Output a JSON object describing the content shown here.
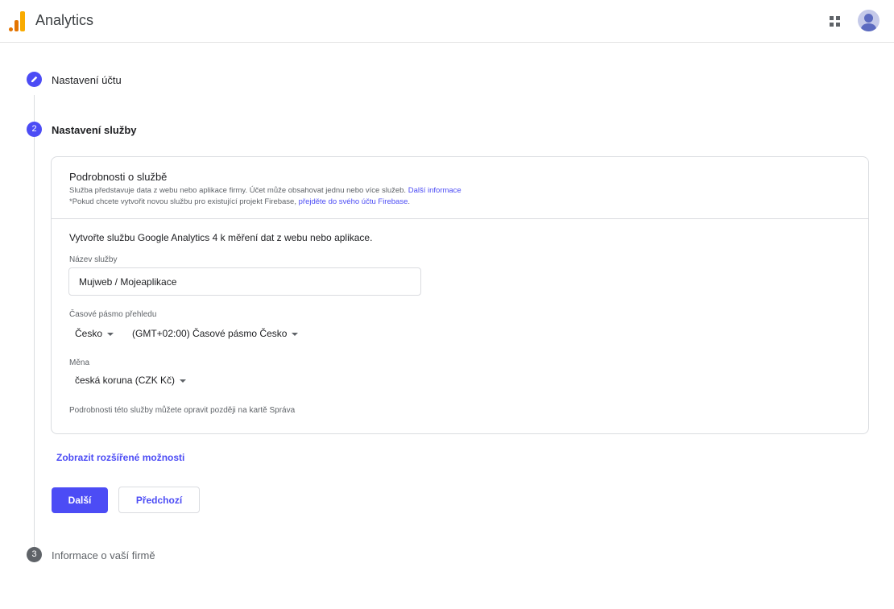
{
  "header": {
    "app_title": "Analytics",
    "apps_icon": "apps-grid-icon",
    "avatar_icon": "account-avatar-icon"
  },
  "steps": [
    {
      "number": "",
      "icon": "pencil-icon",
      "label": "Nastavení účtu",
      "state": "completed"
    },
    {
      "number": "2",
      "label": "Nastavení služby",
      "state": "active"
    },
    {
      "number": "3",
      "label": "Informace o vaší firmě",
      "state": "pending"
    }
  ],
  "card": {
    "title": "Podrobnosti o službě",
    "desc1_text": "Služba představuje data z webu nebo aplikace firmy. Účet může obsahovat jednu nebo více služeb. ",
    "desc1_link": "Další informace",
    "desc2_text": "*Pokud chcete vytvořit novou službu pro existující projekt Firebase, ",
    "desc2_link": "přejděte do svého účtu Firebase",
    "desc2_end": ".",
    "intro": "Vytvořte službu Google Analytics 4 k měření dat z webu nebo aplikace.",
    "service_name_label": "Název služby",
    "service_name_value": "Mujweb / Mojeaplikace",
    "timezone_label": "Časové pásmo přehledu",
    "country_value": "Česko",
    "timezone_value": "(GMT+02:00) Časové pásmo Česko",
    "currency_label": "Měna",
    "currency_value": "česká koruna (CZK Kč)",
    "foot_note": "Podrobnosti této služby můžete opravit později na kartě Správa"
  },
  "advanced_link": "Zobrazit rozšířené možnosti",
  "buttons": {
    "next": "Další",
    "previous": "Předchozí"
  },
  "colors": {
    "accent": "#4c4cf5",
    "logo_orange": "#e37400",
    "logo_yellow": "#f9ab00"
  }
}
